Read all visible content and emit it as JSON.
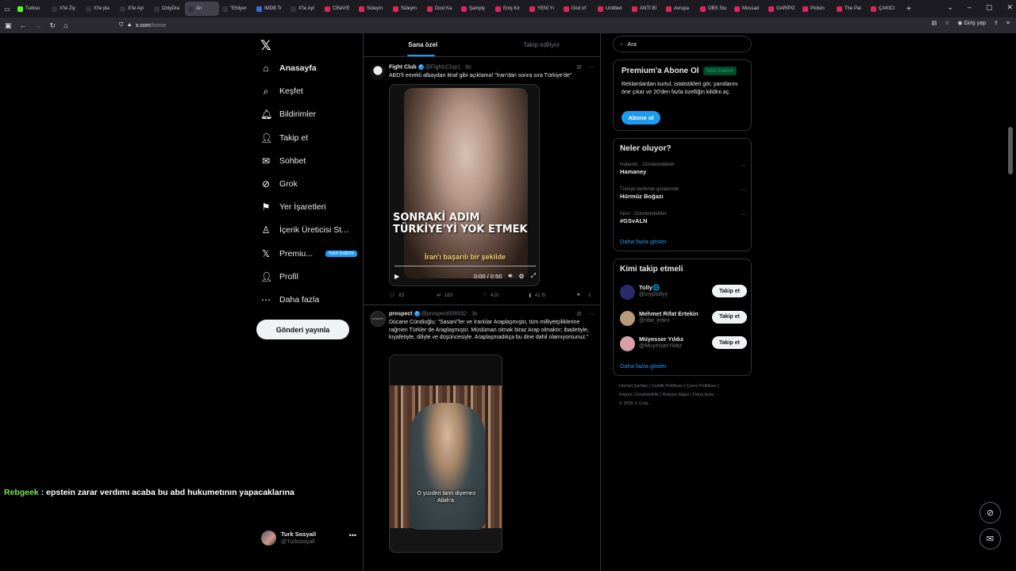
{
  "browser": {
    "tabs": [
      {
        "label": "Turkso",
        "color": "#53fc18"
      },
      {
        "label": "X'te Ziy",
        "color": "#333"
      },
      {
        "label": "X'te pla",
        "color": "#333"
      },
      {
        "label": "X'te Ayl",
        "color": "#333"
      },
      {
        "label": "OnlyDra",
        "color": "#333"
      },
      {
        "label": "An",
        "color": "#333",
        "active": true
      },
      {
        "label": "\"Ehliyer",
        "color": "#333"
      },
      {
        "label": "IMDB Tr",
        "color": "#3a6ed8"
      },
      {
        "label": "X'te Ayl",
        "color": "#333"
      },
      {
        "label": "CİNAYE",
        "color": "#e0245e"
      },
      {
        "label": "Süleym",
        "color": "#e0245e"
      },
      {
        "label": "Süleym",
        "color": "#e0245e"
      },
      {
        "label": "Dost Ka",
        "color": "#e0245e"
      },
      {
        "label": "Şampiy",
        "color": "#e0245e"
      },
      {
        "label": "Eniş Kır",
        "color": "#e0245e"
      },
      {
        "label": "YENİ Yı",
        "color": "#e0245e"
      },
      {
        "label": "God of",
        "color": "#e0245e"
      },
      {
        "label": "Untitled",
        "color": "#e0245e"
      },
      {
        "label": "ANTİ Bİ",
        "color": "#e0245e"
      },
      {
        "label": "Avrupa",
        "color": "#e0245e"
      },
      {
        "label": "OBS Stu",
        "color": "#e0245e"
      },
      {
        "label": "Mossad",
        "color": "#e0245e"
      },
      {
        "label": "GARİPO",
        "color": "#e0245e"
      },
      {
        "label": "Polisin",
        "color": "#e0245e"
      },
      {
        "label": "The Pal",
        "color": "#e0245e"
      },
      {
        "label": "ÇAKICI",
        "color": "#e0245e"
      }
    ],
    "url_host": "x.com",
    "url_path": "/home",
    "signin": "Giriş yap"
  },
  "nav": {
    "items": [
      {
        "label": "Anasayfa",
        "icon": "home-icon",
        "glyph": "⌂"
      },
      {
        "label": "Keşfet",
        "icon": "search-icon",
        "glyph": "⌕"
      },
      {
        "label": "Bildirimler",
        "icon": "bell-icon",
        "glyph": "🔔︎"
      },
      {
        "label": "Takip et",
        "icon": "follow-icon",
        "glyph": "👤︎"
      },
      {
        "label": "Sohbet",
        "icon": "mail-icon",
        "glyph": "✉"
      },
      {
        "label": "Grok",
        "icon": "grok-icon",
        "glyph": "⊘"
      },
      {
        "label": "Yer İşaretleri",
        "icon": "bookmark-icon",
        "glyph": "⚑"
      },
      {
        "label": "İçerik Üreticisi St...",
        "icon": "creator-icon",
        "glyph": "♙"
      },
      {
        "label": "Premiu...",
        "icon": "x-premium-icon",
        "glyph": "𝕏"
      },
      {
        "label": "Profil",
        "icon": "profile-icon",
        "glyph": "👤︎"
      },
      {
        "label": "Daha fazla",
        "icon": "more-icon",
        "glyph": "⋯"
      }
    ],
    "premium_badge": "%50 İndirim",
    "post_button": "Gönderi yayınla",
    "account_name": "Turk Sosyall",
    "account_handle": "@Turksosyall"
  },
  "overlay_chat": {
    "user": "Rebgeek",
    "message": " : epstein zarar verdımı acaba bu abd hukumetının yapacaklarına"
  },
  "feed": {
    "tabs": [
      "Sana özel",
      "Takip ediliyor"
    ],
    "tweet1": {
      "name": "Fight Club",
      "handle": "@FightcClup1",
      "time": "· 8s",
      "text": "ABD'li emekli albaydan itiraf gibi açıklama! \"İran'dan sonra sıra Türkiye'de\"",
      "video_caption": "SONRAKİ ADIM TÜRKİYE'Yİ YOK ETMEK",
      "video_subtitle": "İran'ı başarılı bir şekilde",
      "video_time": "0:00 / 0:50",
      "replies": "83",
      "reposts": "183",
      "likes": "420",
      "views": "41 B"
    },
    "tweet2": {
      "name": "prospect",
      "handle": "@prospect006532",
      "time": "· 3s",
      "avatar_text": "prospect",
      "text": "Dücane Cündioğlu: \"Sasani\"ler ve İranlılar Araplaşmıştır, tüm milliyetçiliklerine rağmen Türkler de Araplaşmıştır. Müslüman olmak biraz Arap olmaktır; ibadetiyle, kıyafetiyle, diliyle ve düşüncesiyle. Araplaşmadıkça bu dine dahil olamıyorsunuz.\"",
      "video_caption_1": "O yüzden tanrı diyemez",
      "video_caption_2": "Allah'a."
    }
  },
  "right": {
    "search_placeholder": "Ara",
    "premium_title": "Premium'a Abone Ol",
    "premium_discount": "%50 İndirim",
    "premium_desc": "Reklamlardan kurtul, istatistikleri gör, yanıtlarını öne çıkar ve 20'den fazla özelliğin kilidini aç.",
    "premium_button": "Abone ol",
    "trends_title": "Neler oluyor?",
    "trends": [
      {
        "category": "Haberler · Gündemdekiler",
        "name": "Hamaney"
      },
      {
        "category": "Türkiye tarihinde gündemde",
        "name": "Hürmüz Boğazı"
      },
      {
        "category": "Spor · Gündemdekiler",
        "name": "#GSvALN"
      }
    ],
    "show_more": "Daha fazla göster",
    "follow_title": "Kimi takip etmeli",
    "follow_users": [
      {
        "name": "Tolly🌐",
        "handle": "@cryptollyy",
        "button": "Takip et",
        "color": "#2a2a6a"
      },
      {
        "name": "Mehmet Rifat Ertekin",
        "handle": "@rifat_ertkn",
        "button": "Takip et",
        "color": "#b99a7a"
      },
      {
        "name": "Müyesser Yıldız",
        "handle": "@MuyesserYildiz",
        "button": "Takip et",
        "color": "#d8a0a6"
      }
    ],
    "footer": {
      "line1": "Hizmet Şartları  |  Gizlilik Politikası  |  Çerez Politikası  |",
      "line2": "Imprint  |  Erişilebilirlik  |  Reklam bilgisi  |  Daha fazla ···",
      "line3": "© 2026 X Corp."
    }
  }
}
